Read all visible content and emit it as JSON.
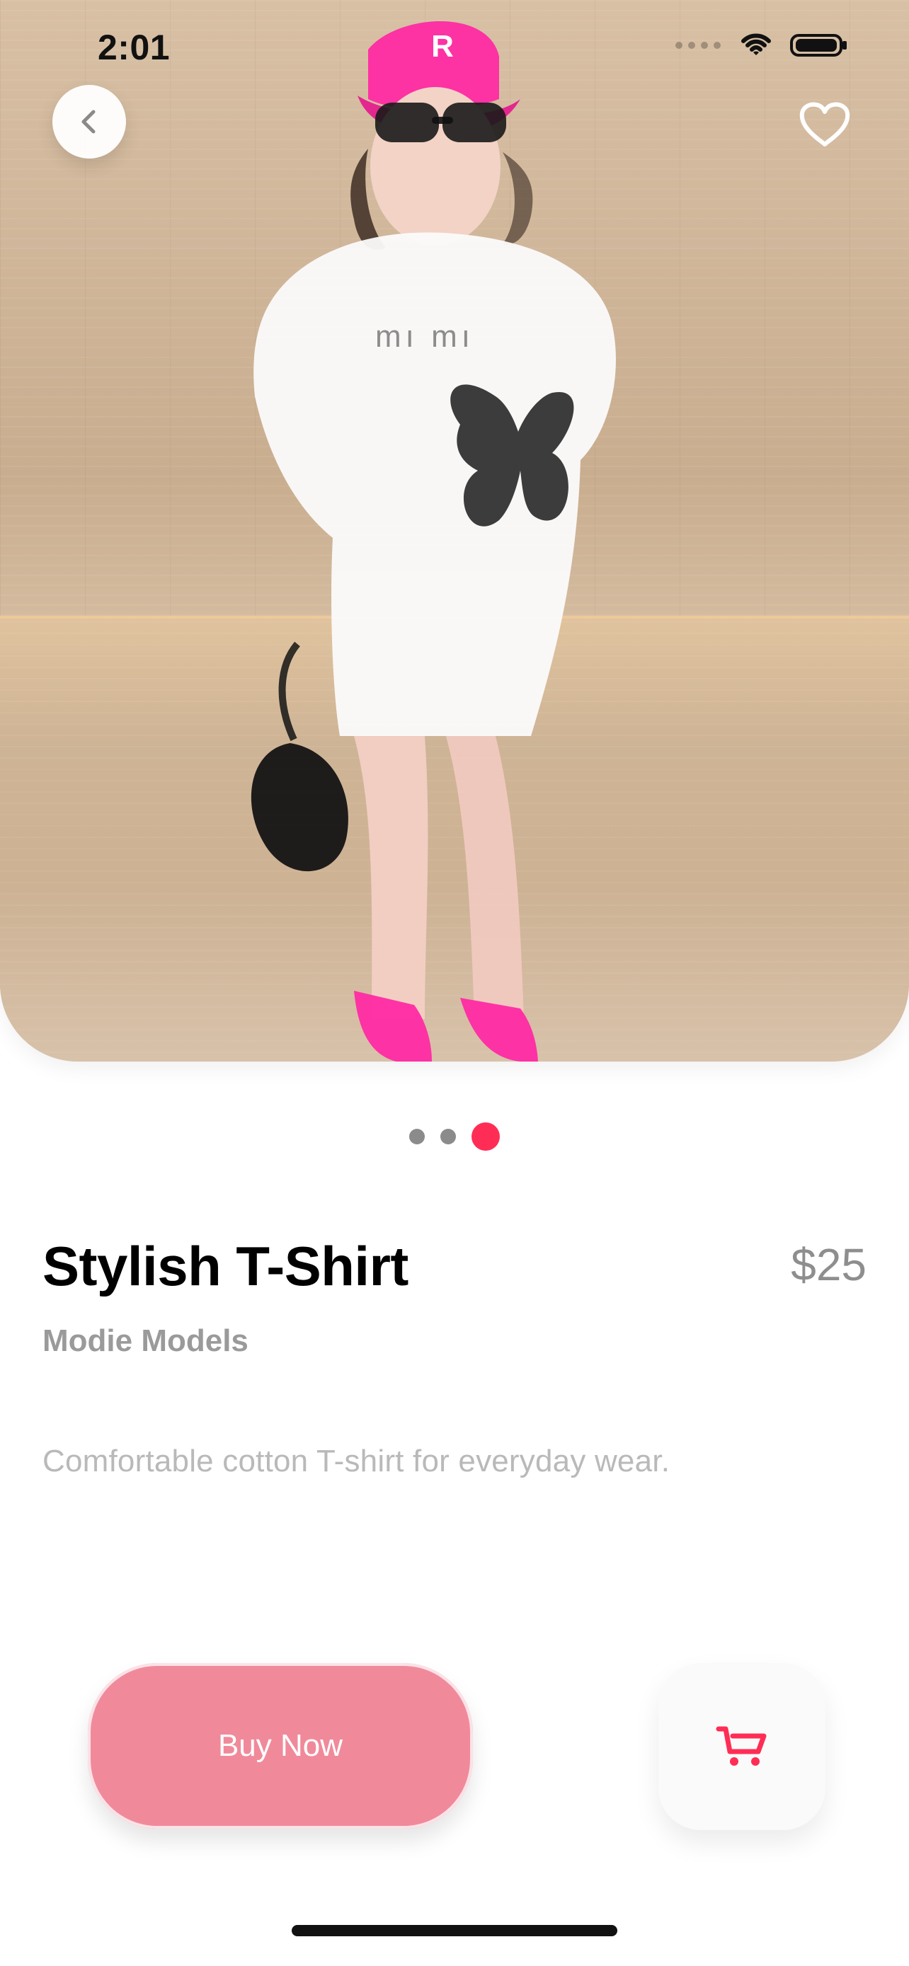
{
  "status_bar": {
    "time": "2:01"
  },
  "product": {
    "title": "Stylish T-Shirt",
    "price": "$25",
    "brand": "Modie Models",
    "description": "Comfortable cotton T-shirt for everyday wear."
  },
  "actions": {
    "buy_now_label": "Buy Now"
  },
  "icons": {
    "back": "chevron-left-icon",
    "favorite": "heart-outline-icon",
    "cart": "shopping-cart-icon"
  },
  "colors": {
    "accent": "#ff2d55",
    "buy_button": "#f08a9b"
  }
}
